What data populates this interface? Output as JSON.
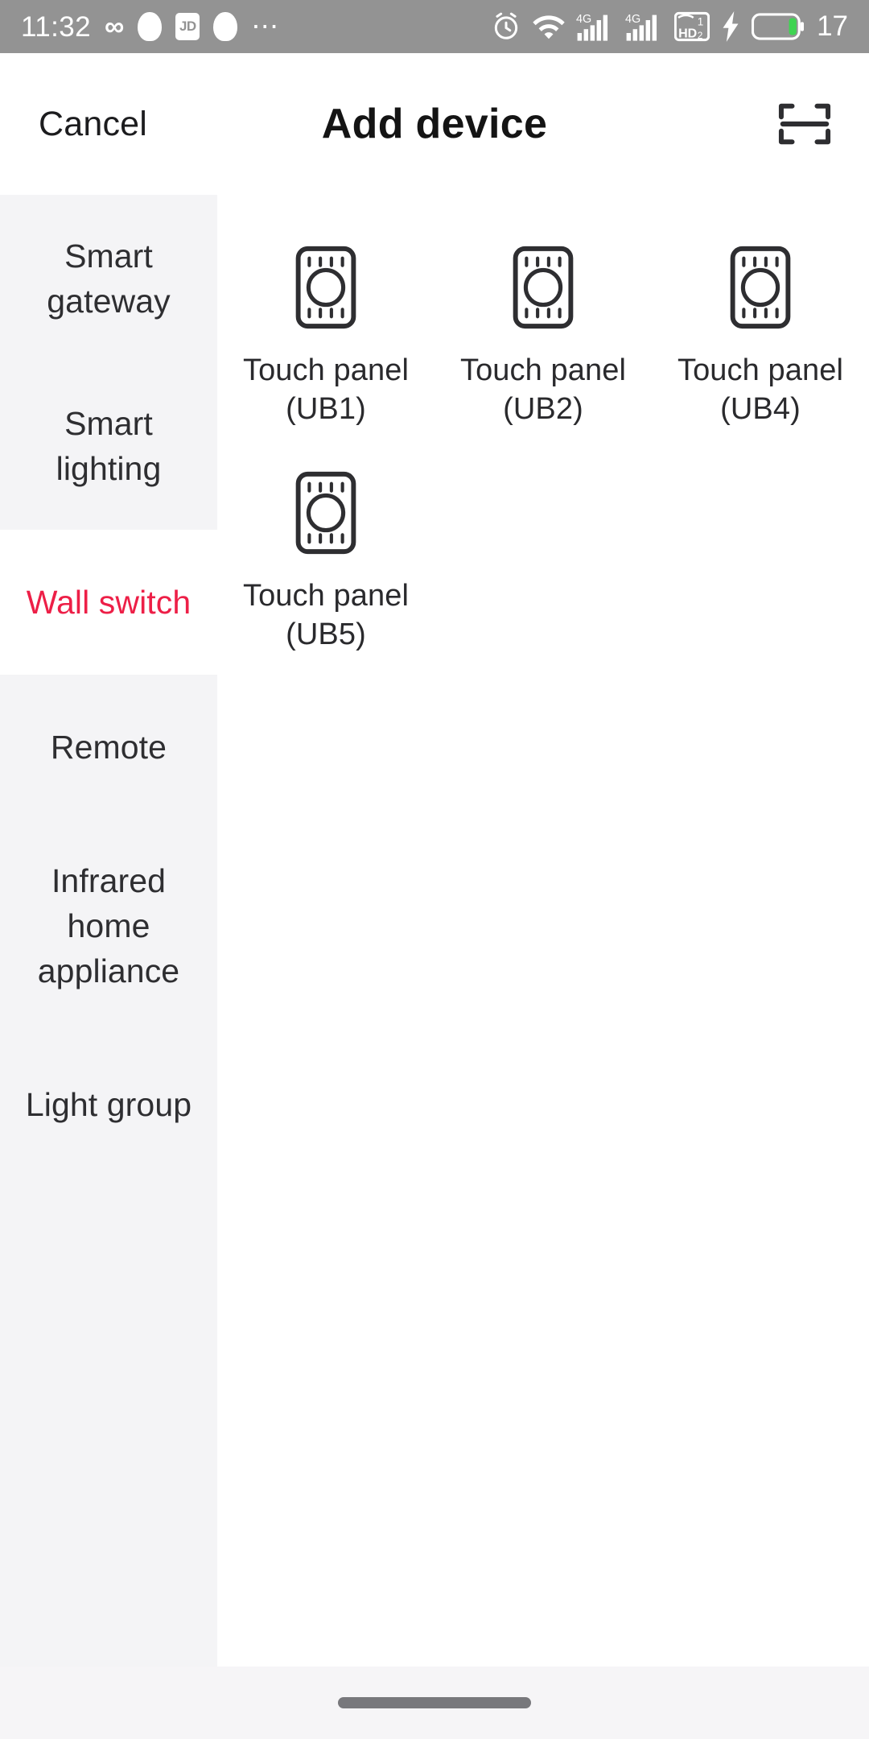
{
  "status_bar": {
    "time": "11:32",
    "battery_level": "17",
    "background_color": "#939393",
    "left_icons": [
      {
        "name": "infinity-icon",
        "glyph": "∞"
      },
      {
        "name": "app-notification-icon",
        "glyph": ""
      },
      {
        "name": "jd-app-icon",
        "glyph": "JD"
      },
      {
        "name": "app-notification-icon-2",
        "glyph": ""
      },
      {
        "name": "more-notifications-icon",
        "glyph": "•••"
      }
    ],
    "right_icons": [
      {
        "name": "alarm-clock-icon"
      },
      {
        "name": "wifi-icon"
      },
      {
        "name": "signal-4g-sim1-icon",
        "label": "4G"
      },
      {
        "name": "signal-4g-sim2-icon",
        "label": "4G"
      },
      {
        "name": "volte-hd-icon",
        "label": "HD"
      },
      {
        "name": "charging-bolt-icon"
      },
      {
        "name": "battery-icon"
      }
    ]
  },
  "header": {
    "cancel_label": "Cancel",
    "title": "Add device",
    "scan_icon": "scan-qr-icon"
  },
  "sidebar": {
    "background_color": "#f4f4f6",
    "selected_color": "#ed1f47",
    "selected_index": 2,
    "items": [
      {
        "label": "Smart gateway",
        "lines": [
          "Smart",
          "gateway"
        ],
        "selected": false
      },
      {
        "label": "Smart lighting",
        "lines": [
          "Smart",
          "lighting"
        ],
        "selected": false
      },
      {
        "label": "Wall switch",
        "lines": [
          "Wall switch"
        ],
        "selected": true
      },
      {
        "label": "Remote",
        "lines": [
          "Remote"
        ],
        "selected": false
      },
      {
        "label": "Infrared home appliance",
        "lines": [
          "Infrared",
          "home",
          "appliance"
        ],
        "selected": false
      },
      {
        "label": "Light group",
        "lines": [
          "Light group"
        ],
        "selected": false
      }
    ]
  },
  "content": {
    "devices": [
      {
        "name_line1": "Touch panel",
        "name_line2": "(UB1)",
        "icon": "touch-panel-icon"
      },
      {
        "name_line1": "Touch panel",
        "name_line2": "(UB2)",
        "icon": "touch-panel-icon"
      },
      {
        "name_line1": "Touch panel",
        "name_line2": "(UB4)",
        "icon": "touch-panel-icon"
      },
      {
        "name_line1": "Touch panel",
        "name_line2": "(UB5)",
        "icon": "touch-panel-icon"
      }
    ]
  },
  "bottom": {
    "gesture_bar": "home-gesture-indicator"
  }
}
